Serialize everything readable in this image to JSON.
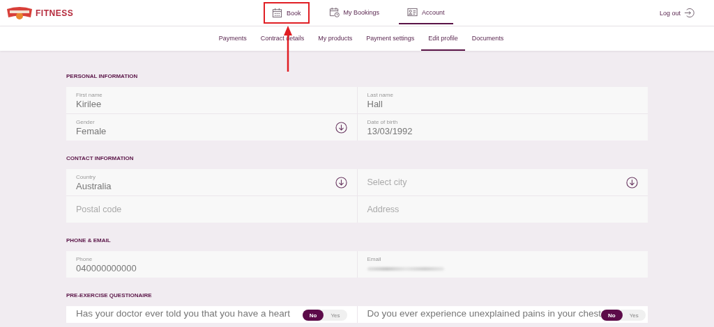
{
  "brand": {
    "name": "FITNESS"
  },
  "nav": [
    {
      "label": "Book",
      "selected": false,
      "highlighted": true
    },
    {
      "label": "My Bookings",
      "selected": false,
      "highlighted": false
    },
    {
      "label": "Account",
      "selected": true,
      "highlighted": false
    }
  ],
  "logout": {
    "label": "Log out"
  },
  "subnav": [
    {
      "label": "Payments",
      "selected": false
    },
    {
      "label": "Contract details",
      "selected": false
    },
    {
      "label": "My products",
      "selected": false
    },
    {
      "label": "Payment settings",
      "selected": false
    },
    {
      "label": "Edit profile",
      "selected": true
    },
    {
      "label": "Documents",
      "selected": false
    }
  ],
  "sections": [
    {
      "title": "PERSONAL INFORMATION",
      "kind": "fields",
      "fields": [
        {
          "kind": "text",
          "label": "First name",
          "value": "Kirilee"
        },
        {
          "kind": "text",
          "label": "Last name",
          "value": "Hall"
        },
        {
          "kind": "select",
          "label": "Gender",
          "value": "Female"
        },
        {
          "kind": "text",
          "label": "Date of birth",
          "value": "13/03/1992"
        }
      ]
    },
    {
      "title": "CONTACT INFORMATION",
      "kind": "fields",
      "fields": [
        {
          "kind": "select",
          "label": "Country",
          "value": "Australia"
        },
        {
          "kind": "select",
          "placeholder": "Select city"
        },
        {
          "kind": "text",
          "placeholder": "Postal code"
        },
        {
          "kind": "text",
          "placeholder": "Address"
        }
      ]
    },
    {
      "title": "PHONE & EMAIL",
      "kind": "fields",
      "fields": [
        {
          "kind": "text",
          "label": "Phone",
          "value": "040000000000"
        },
        {
          "kind": "redacted",
          "label": "Email"
        }
      ]
    },
    {
      "title": "PRE-EXERCISE QUESTIONAIRE",
      "kind": "questions",
      "questions": [
        {
          "text": "Has your doctor ever told you that you have a heart",
          "options": [
            {
              "label": "No",
              "selected": true
            },
            {
              "label": "Yes",
              "selected": false
            }
          ]
        },
        {
          "text": "Do you ever experience unexplained pains in your chest",
          "options": [
            {
              "label": "No",
              "selected": true
            },
            {
              "label": "Yes",
              "selected": false
            }
          ]
        }
      ]
    }
  ],
  "annotation": {
    "arrow": true
  }
}
